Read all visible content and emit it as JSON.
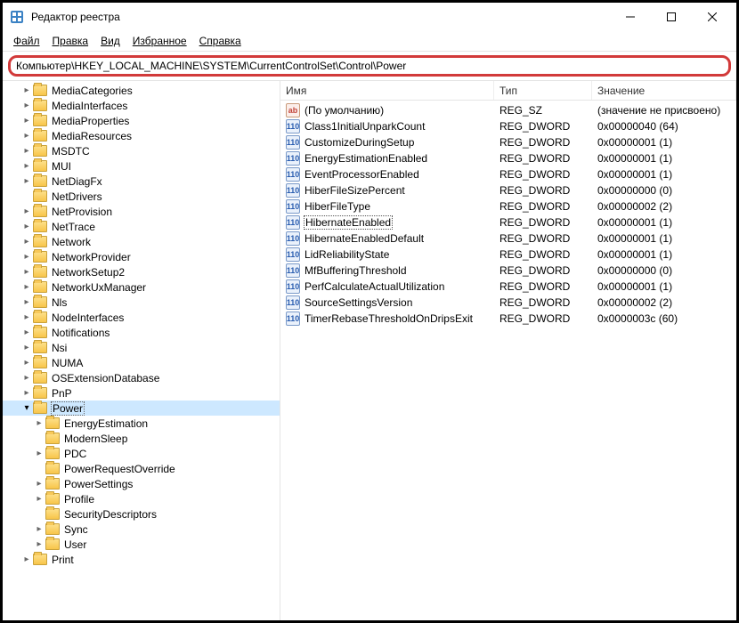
{
  "window": {
    "title": "Редактор реестра"
  },
  "menu": {
    "file": "Файл",
    "edit": "Правка",
    "view": "Вид",
    "favorites": "Избранное",
    "help": "Справка"
  },
  "address": "Компьютер\\HKEY_LOCAL_MACHINE\\SYSTEM\\CurrentControlSet\\Control\\Power",
  "columns": {
    "name": "Имя",
    "type": "Тип",
    "value": "Значение"
  },
  "tree": [
    {
      "d": 1,
      "c": ">",
      "l": "MediaCategories"
    },
    {
      "d": 1,
      "c": ">",
      "l": "MediaInterfaces"
    },
    {
      "d": 1,
      "c": ">",
      "l": "MediaProperties"
    },
    {
      "d": 1,
      "c": ">",
      "l": "MediaResources"
    },
    {
      "d": 1,
      "c": ">",
      "l": "MSDTC"
    },
    {
      "d": 1,
      "c": ">",
      "l": "MUI"
    },
    {
      "d": 1,
      "c": ">",
      "l": "NetDiagFx"
    },
    {
      "d": 1,
      "c": "",
      "l": "NetDrivers"
    },
    {
      "d": 1,
      "c": ">",
      "l": "NetProvision"
    },
    {
      "d": 1,
      "c": ">",
      "l": "NetTrace"
    },
    {
      "d": 1,
      "c": ">",
      "l": "Network"
    },
    {
      "d": 1,
      "c": ">",
      "l": "NetworkProvider"
    },
    {
      "d": 1,
      "c": ">",
      "l": "NetworkSetup2"
    },
    {
      "d": 1,
      "c": ">",
      "l": "NetworkUxManager"
    },
    {
      "d": 1,
      "c": ">",
      "l": "Nls"
    },
    {
      "d": 1,
      "c": ">",
      "l": "NodeInterfaces"
    },
    {
      "d": 1,
      "c": ">",
      "l": "Notifications"
    },
    {
      "d": 1,
      "c": ">",
      "l": "Nsi"
    },
    {
      "d": 1,
      "c": ">",
      "l": "NUMA"
    },
    {
      "d": 1,
      "c": ">",
      "l": "OSExtensionDatabase"
    },
    {
      "d": 1,
      "c": ">",
      "l": "PnP"
    },
    {
      "d": 1,
      "c": "v",
      "l": "Power",
      "sel": true
    },
    {
      "d": 2,
      "c": ">",
      "l": "EnergyEstimation"
    },
    {
      "d": 2,
      "c": "",
      "l": "ModernSleep"
    },
    {
      "d": 2,
      "c": ">",
      "l": "PDC"
    },
    {
      "d": 2,
      "c": "",
      "l": "PowerRequestOverride"
    },
    {
      "d": 2,
      "c": ">",
      "l": "PowerSettings"
    },
    {
      "d": 2,
      "c": ">",
      "l": "Profile"
    },
    {
      "d": 2,
      "c": "",
      "l": "SecurityDescriptors"
    },
    {
      "d": 2,
      "c": ">",
      "l": "Sync"
    },
    {
      "d": 2,
      "c": ">",
      "l": "User"
    },
    {
      "d": 1,
      "c": ">",
      "l": "Print"
    }
  ],
  "values": [
    {
      "icon": "str",
      "name": "(По умолчанию)",
      "type": "REG_SZ",
      "val": "(значение не присвоено)"
    },
    {
      "icon": "bin",
      "name": "Class1InitialUnparkCount",
      "type": "REG_DWORD",
      "val": "0x00000040 (64)"
    },
    {
      "icon": "bin",
      "name": "CustomizeDuringSetup",
      "type": "REG_DWORD",
      "val": "0x00000001 (1)"
    },
    {
      "icon": "bin",
      "name": "EnergyEstimationEnabled",
      "type": "REG_DWORD",
      "val": "0x00000001 (1)"
    },
    {
      "icon": "bin",
      "name": "EventProcessorEnabled",
      "type": "REG_DWORD",
      "val": "0x00000001 (1)"
    },
    {
      "icon": "bin",
      "name": "HiberFileSizePercent",
      "type": "REG_DWORD",
      "val": "0x00000000 (0)"
    },
    {
      "icon": "bin",
      "name": "HiberFileType",
      "type": "REG_DWORD",
      "val": "0x00000002 (2)"
    },
    {
      "icon": "bin",
      "name": "HibernateEnabled",
      "type": "REG_DWORD",
      "val": "0x00000001 (1)",
      "sel": true
    },
    {
      "icon": "bin",
      "name": "HibernateEnabledDefault",
      "type": "REG_DWORD",
      "val": "0x00000001 (1)"
    },
    {
      "icon": "bin",
      "name": "LidReliabilityState",
      "type": "REG_DWORD",
      "val": "0x00000001 (1)"
    },
    {
      "icon": "bin",
      "name": "MfBufferingThreshold",
      "type": "REG_DWORD",
      "val": "0x00000000 (0)"
    },
    {
      "icon": "bin",
      "name": "PerfCalculateActualUtilization",
      "type": "REG_DWORD",
      "val": "0x00000001 (1)"
    },
    {
      "icon": "bin",
      "name": "SourceSettingsVersion",
      "type": "REG_DWORD",
      "val": "0x00000002 (2)"
    },
    {
      "icon": "bin",
      "name": "TimerRebaseThresholdOnDripsExit",
      "type": "REG_DWORD",
      "val": "0x0000003c (60)"
    }
  ],
  "icons": {
    "str": "ab",
    "bin": "110"
  }
}
